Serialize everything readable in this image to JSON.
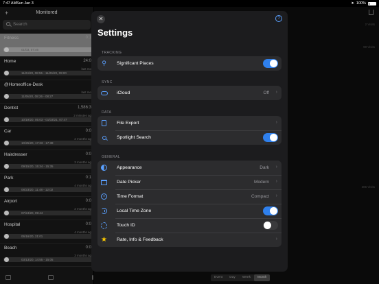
{
  "status": {
    "time": "7:47 AM",
    "date": "Sun Jan 3",
    "battery": "100%"
  },
  "sidebar": {
    "title": "Monitored",
    "add": "+",
    "search_placeholder": "Search",
    "items": [
      {
        "name": "Fitness",
        "value": "0:1",
        "meta": "",
        "dates": "01/03, 07:46",
        "selected": true
      },
      {
        "name": "Home",
        "value": "24:0",
        "meta": "last mo",
        "dates": "11/24/20, 08:55 - 11/26/20, 09:00"
      },
      {
        "name": "@Homeoffice-Desk",
        "value": "",
        "meta": "last mo",
        "dates": "11/06/20, 08:26 - 08:27"
      },
      {
        "name": "Dentist",
        "value": "1,586:3",
        "meta": "2 minutes ag",
        "dates": "10/19/20, 05:03 - 01/03/21, 07:47"
      },
      {
        "name": "Car",
        "value": "0:0",
        "meta": "2 months ag",
        "dates": "10/25/20, 17:33 - 17:38"
      },
      {
        "name": "Hairdresser",
        "value": "0:0",
        "meta": "3 months ag",
        "dates": "09/15/20, 15:34 - 15:35"
      },
      {
        "name": "Park",
        "value": "0:1",
        "meta": "4 months ag",
        "dates": "08/23/20, 11:48 - 12:02"
      },
      {
        "name": "Airport",
        "value": "0:0",
        "meta": "2 months ag",
        "dates": "07/24/20, 09:44"
      },
      {
        "name": "Hospital",
        "value": "0:0",
        "meta": "4 months ag",
        "dates": "06/16/20, 21:01"
      },
      {
        "name": "Beach",
        "value": "0:0",
        "meta": "3 months ag",
        "dates": "03/13/20, 14:55 - 15:05"
      }
    ]
  },
  "content": {
    "visits": [
      "2 Visits",
      "90 Visits",
      "386 Visits"
    ],
    "segments": [
      "Event",
      "Day",
      "Week",
      "Month"
    ],
    "active_segment": "Month"
  },
  "settings": {
    "close": "✕",
    "help": "?",
    "title": "Settings",
    "sections": {
      "tracking": {
        "label": "TRACKING",
        "rows": [
          {
            "label": "Significant Places",
            "icon": "pin-icon",
            "toggle": true
          }
        ]
      },
      "sync": {
        "label": "SYNC",
        "rows": [
          {
            "label": "iCloud",
            "icon": "cloud-icon",
            "detail": "Off"
          }
        ]
      },
      "data": {
        "label": "DATA",
        "rows": [
          {
            "label": "File Export",
            "icon": "document-icon"
          },
          {
            "label": "Spotlight Search",
            "icon": "magnifier-icon",
            "toggle": true
          }
        ]
      },
      "general": {
        "label": "GENERAL",
        "rows": [
          {
            "label": "Appearance",
            "icon": "appearance-icon",
            "detail": "Dark"
          },
          {
            "label": "Date Picker",
            "icon": "calendar-icon",
            "detail": "Modern"
          },
          {
            "label": "Time Format",
            "icon": "clock-icon",
            "detail": "Compact"
          },
          {
            "label": "Local Time Zone",
            "icon": "history-icon",
            "toggle": true
          },
          {
            "label": "Touch ID",
            "icon": "fingerprint-icon",
            "toggle": false
          },
          {
            "label": "Rate, Info & Feedback",
            "icon": "star-icon"
          }
        ]
      }
    }
  },
  "colors": {
    "accent": "#2f80ed",
    "star": "#ffcc00",
    "modal_bg": "#1c1c1e",
    "row_bg": "#2c2c2e"
  }
}
